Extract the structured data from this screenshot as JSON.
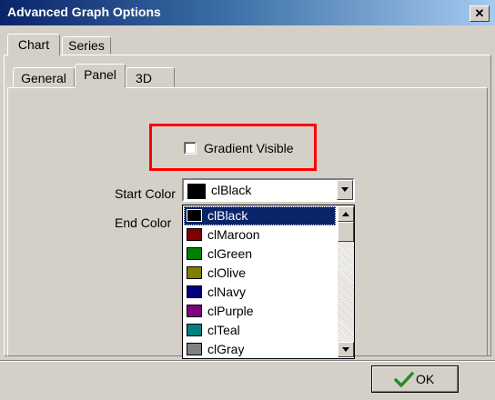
{
  "window": {
    "title": "Advanced Graph Options",
    "close_glyph": "✕"
  },
  "tabs": [
    {
      "label": "Chart",
      "selected": true
    },
    {
      "label": "Series",
      "selected": false
    }
  ],
  "subtabs": [
    {
      "label": "General",
      "selected": false
    },
    {
      "label": "Panel",
      "selected": true
    },
    {
      "label": "3D",
      "selected": false
    }
  ],
  "panel": {
    "gradient_label": "Gradient Visible",
    "gradient_checked": false,
    "start_color_label": "Start Color",
    "end_color_label": "End Color",
    "start_color": {
      "name": "clBlack",
      "swatch": "#000000"
    },
    "color_options": [
      {
        "name": "clBlack",
        "swatch": "#000000",
        "selected": true
      },
      {
        "name": "clMaroon",
        "swatch": "#800000",
        "selected": false
      },
      {
        "name": "clGreen",
        "swatch": "#008000",
        "selected": false
      },
      {
        "name": "clOlive",
        "swatch": "#808000",
        "selected": false
      },
      {
        "name": "clNavy",
        "swatch": "#000080",
        "selected": false
      },
      {
        "name": "clPurple",
        "swatch": "#800080",
        "selected": false
      },
      {
        "name": "clTeal",
        "swatch": "#008080",
        "selected": false
      },
      {
        "name": "clGray",
        "swatch": "#808080",
        "selected": false
      }
    ]
  },
  "footer": {
    "ok_label": "OK",
    "ok_icon": "checkmark-icon",
    "ok_icon_color": "#2a8a2a"
  },
  "highlight_color": "#ff0000"
}
